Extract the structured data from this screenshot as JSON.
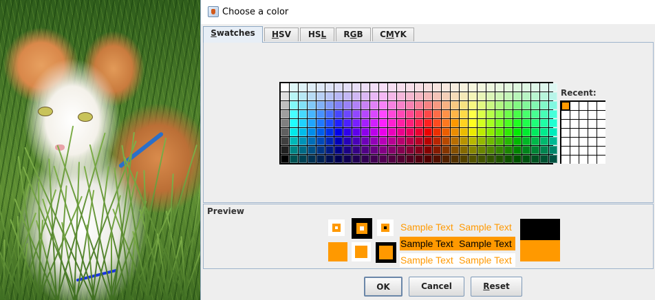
{
  "dialog": {
    "title": "Choose a color",
    "tabs": [
      {
        "mnemonic": "S",
        "rest": "watches",
        "active": true
      },
      {
        "mnemonic": "H",
        "rest": "SV",
        "active": false
      },
      {
        "pre": "HS",
        "mnemonic": "L",
        "active": false
      },
      {
        "pre": "R",
        "mnemonic": "G",
        "rest": "B",
        "active": false
      },
      {
        "pre": "C",
        "mnemonic": "M",
        "rest": "YK",
        "active": false
      }
    ]
  },
  "swatches": {
    "recent_label": "Recent:",
    "selected_color": "#ff9900",
    "recent_colors": [
      "#ff9900"
    ]
  },
  "preview": {
    "label": "Preview",
    "sample_text": "Sample Text",
    "color": "#ff9900"
  },
  "buttons": {
    "ok": "OK",
    "cancel": "Cancel",
    "reset_mnemonic": "R",
    "reset_rest": "eset"
  },
  "colors": {
    "accent": "#ff9900",
    "black": "#000000",
    "white": "#ffffff"
  }
}
